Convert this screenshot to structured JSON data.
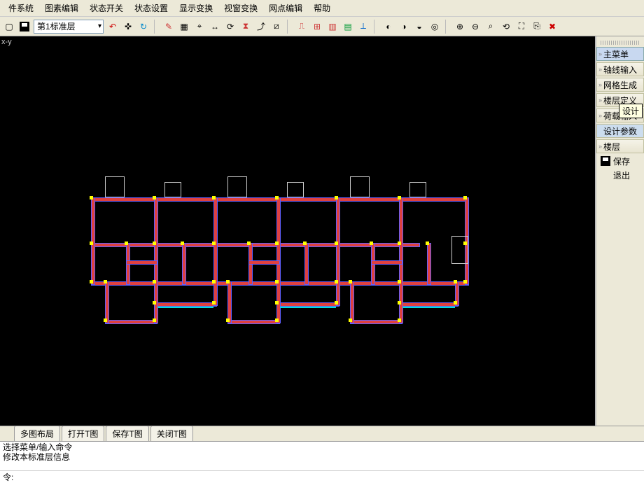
{
  "menubar": [
    "件系统",
    "图素编辑",
    "状态开关",
    "状态设置",
    "显示变换",
    "视窗变换",
    "网点编辑",
    "帮助"
  ],
  "toolbar": {
    "layer_label": "第1标准层",
    "icons": [
      "new-icon",
      "save-icon",
      "dropdown",
      "back-icon",
      "cross-icon",
      "redo-icon",
      "pencil-icon",
      "grid4-icon",
      "pick-icon",
      "move-icon",
      "rotate-icon",
      "mirror-icon",
      "arc-icon",
      "measure-icon",
      "sep",
      "col1-icon",
      "grid-red-icon",
      "wall-icon",
      "sheet-icon",
      "ruler-icon",
      "sep",
      "circle-a-icon",
      "circle-b-icon",
      "circle-c-icon",
      "target-icon",
      "sep",
      "zoom-in-icon",
      "zoom-out-icon",
      "zoom-area-icon",
      "zoom-prev-icon",
      "zoom-fit-icon",
      "copy-icon",
      "cancel-icon"
    ]
  },
  "viewport": {
    "axis_label": "x-y"
  },
  "side": {
    "items": [
      {
        "label": "主菜单",
        "active": true
      },
      {
        "label": "轴线输入"
      },
      {
        "label": "网格生成"
      },
      {
        "label": "楼层定义"
      },
      {
        "label": "荷载输入"
      },
      {
        "label": "设计参数",
        "highlight": true
      },
      {
        "label": "楼层"
      }
    ],
    "plain": [
      {
        "icon": "save-icon",
        "label": "保存"
      },
      {
        "icon": "",
        "label": "退出"
      }
    ],
    "tooltip": "设计"
  },
  "bottom_tabs": [
    "多图布局",
    "打开T图",
    "保存T图",
    "关闭T图"
  ],
  "command": {
    "history": [
      "选择菜单/输入命令",
      "修改本标准层信息"
    ],
    "prompt": "令:"
  },
  "colors": {
    "wall": "#e04040",
    "wall_edge": "#6060ff",
    "node": "#ffff00",
    "stub": "#cccccc",
    "cyan": "#00dddd",
    "bg": "#000000",
    "panel": "#ece9d8"
  }
}
